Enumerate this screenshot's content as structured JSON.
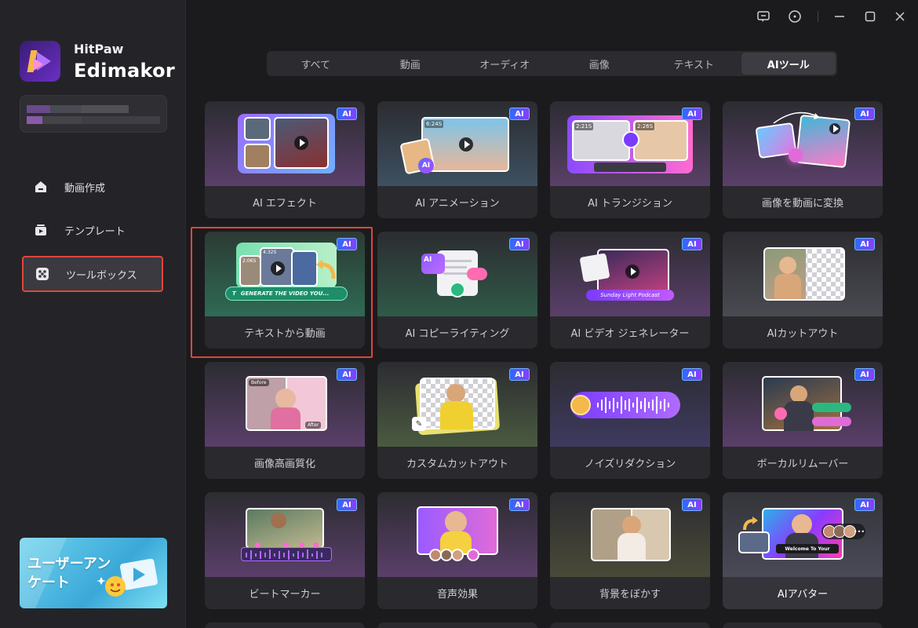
{
  "brand": {
    "small": "HitPaw",
    "big": "Edimakor"
  },
  "sidebar": {
    "items": [
      {
        "label": "動画作成",
        "icon": "home-icon"
      },
      {
        "label": "テンプレート",
        "icon": "template-icon"
      },
      {
        "label": "ツールボックス",
        "icon": "toolbox-icon"
      }
    ],
    "survey_text": "ユーザーアンケート"
  },
  "tabs": [
    {
      "label": "すべて"
    },
    {
      "label": "動画"
    },
    {
      "label": "オーディオ"
    },
    {
      "label": "画像"
    },
    {
      "label": "テキスト"
    },
    {
      "label": "AIツール",
      "active": true
    }
  ],
  "tools": [
    {
      "label": "AI エフェクト",
      "badge": "AI"
    },
    {
      "label": "AI アニメーション",
      "badge": "AI",
      "tag": "6:24S"
    },
    {
      "label": "AI トランジション",
      "badge": "AI",
      "tag": "2:21S",
      "tag2": "2:26S"
    },
    {
      "label": "画像を動画に変換",
      "badge": "AI"
    },
    {
      "label": "テキストから動画",
      "badge": "AI",
      "tag": "4:32S",
      "tag2": "2:06S",
      "prompt": "GENERATE THE VIDEO YOU..."
    },
    {
      "label": "AI コピーライティング",
      "badge": "AI",
      "mini": "AI"
    },
    {
      "label": "AI ビデオ ジェネレーター",
      "badge": "AI",
      "caption": "Sunday Light Podcast"
    },
    {
      "label": "AIカットアウト",
      "badge": "AI"
    },
    {
      "label": "画像高画質化",
      "badge": "AI",
      "before": "Before",
      "after": "After"
    },
    {
      "label": "カスタムカットアウト",
      "badge": "AI"
    },
    {
      "label": "ノイズリダクション",
      "badge": "AI"
    },
    {
      "label": "ボーカルリムーバー",
      "badge": "AI"
    },
    {
      "label": "ビートマーカー",
      "badge": "AI"
    },
    {
      "label": "音声効果",
      "badge": "AI"
    },
    {
      "label": "背景をぼかす",
      "badge": "AI"
    },
    {
      "label": "AIアバター",
      "badge": "AI",
      "caption": "Welcome To Your"
    }
  ],
  "colors": {
    "accent_red": "#e0463a",
    "badge_blue": "#2d6bff",
    "badge_purple": "#8a3dff"
  }
}
